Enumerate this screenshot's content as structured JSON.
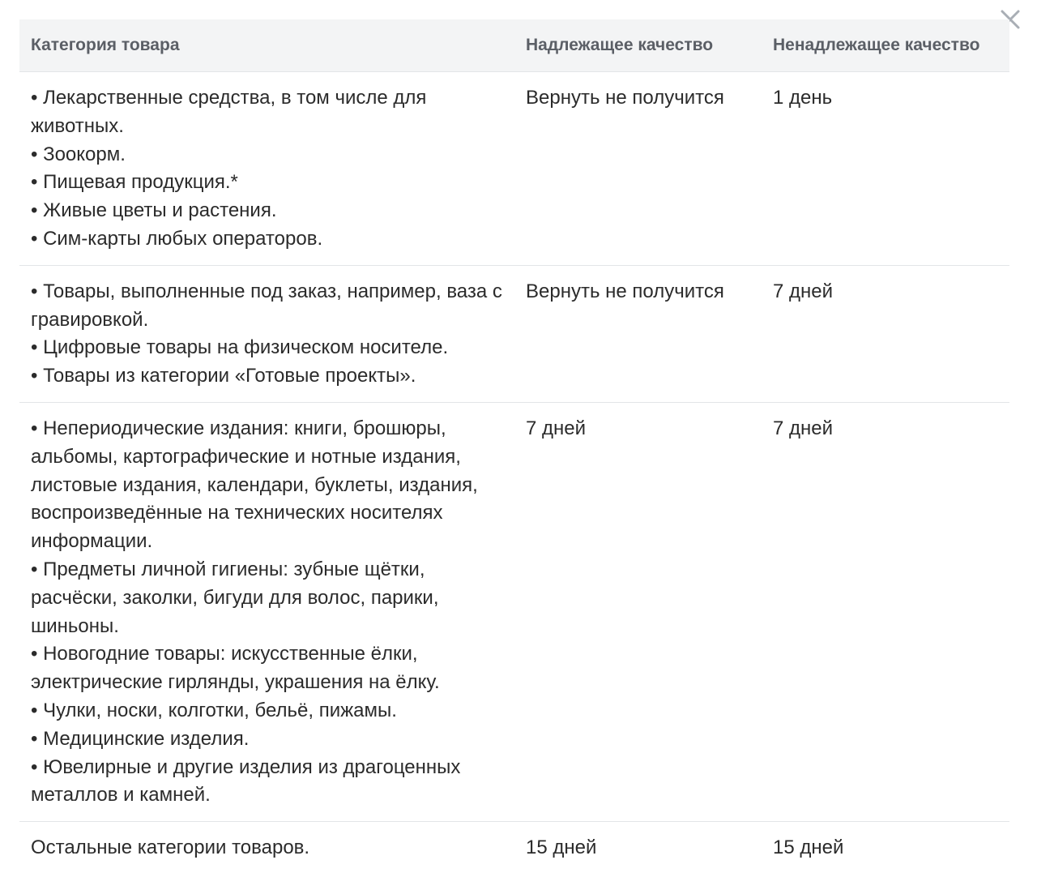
{
  "header": {
    "category": "Категория товара",
    "proper_quality": "Надлежащее качество",
    "improper_quality": "Ненадлежащее качество"
  },
  "rows": [
    {
      "items": [
        "• Лекарственные средства, в том числе для животных.",
        "• Зоокорм.",
        "• Пищевая продукция.*",
        "• Живые цветы и растения.",
        "• Сим-карты любых операторов."
      ],
      "proper": "Вернуть не получится",
      "improper": "1 день"
    },
    {
      "items": [
        "• Товары, выполненные под заказ, например, ваза с гравировкой.",
        "• Цифровые товары на физическом носителе.",
        "• Товары из категории «Готовые проекты»."
      ],
      "proper": "Вернуть не получится",
      "improper": "7 дней"
    },
    {
      "items": [
        "• Непериодические издания: книги, брошюры, альбомы, картографические и нотные издания, листовые издания, календари, буклеты, издания, воспроизведённые на технических носителях информации.",
        "• Предметы личной гигиены: зубные щётки, расчёски, заколки, бигуди для волос, парики, шиньоны.",
        "• Новогодние товары: искусственные ёлки, электрические гирлянды, украшения на ёлку.",
        "• Чулки, носки, колготки, бельё, пижамы.",
        "• Медицинские изделия.",
        "• Ювелирные и другие изделия из драгоценных металлов и камней."
      ],
      "proper": "7 дней",
      "improper": "7 дней"
    },
    {
      "items": [
        "Остальные категории товаров."
      ],
      "proper": "15 дней",
      "improper": "15 дней"
    }
  ],
  "icons": {
    "close": "close-icon"
  },
  "colors": {
    "header_bg": "#f3f4f5",
    "header_text": "#5b5f66",
    "body_text": "#2b2b2b",
    "divider": "#e3e5e8",
    "close_icon": "#a9aeb5"
  }
}
